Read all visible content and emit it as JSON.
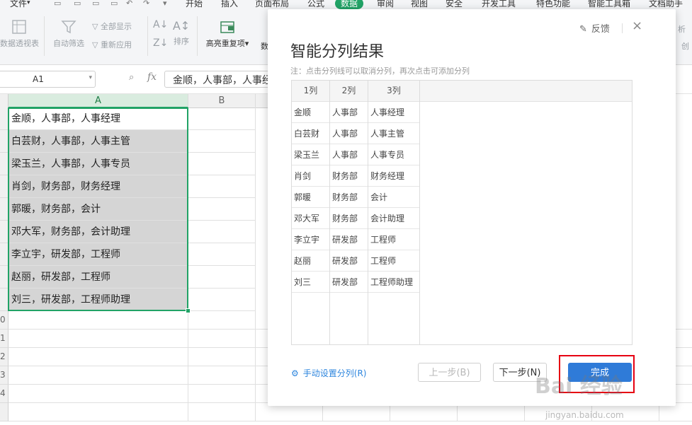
{
  "menu": {
    "items": [
      "文件",
      "开始",
      "插入",
      "页面布局",
      "公式",
      "数据",
      "审阅",
      "视图",
      "安全",
      "开发工具",
      "特色功能",
      "智能工具箱",
      "文档助手"
    ],
    "active": "数据"
  },
  "toolbar": {
    "pivot": "数据透视表",
    "autofilter": "自动筛选",
    "show_all": "全部显示",
    "reapply": "重新应用",
    "sort": "排序",
    "highlight_dup": "高亮重复项",
    "highlight_dup_caret": "▾",
    "data_partial": "数",
    "right_partial_1": "析",
    "right_partial_2": "创"
  },
  "formula_bar": {
    "name_box": "A1",
    "fx": "fx",
    "content": "金顺，人事部，人事经理"
  },
  "sheet": {
    "columns": [
      "A",
      "B"
    ],
    "row_numbers": [
      "0",
      "1",
      "2",
      "3",
      "4"
    ],
    "cells": [
      "金顺，人事部，人事经理",
      "白芸财，人事部，人事主管",
      "梁玉兰，人事部，人事专员",
      "肖剑，财务部，财务经理",
      "郭暖，财务部，会计",
      "邓大军，财务部，会计助理",
      "李立宇，研发部，工程师",
      "赵丽，研发部，工程师",
      "刘三，研发部，工程师助理"
    ]
  },
  "dialog": {
    "title": "智能分列结果",
    "note": "注：点击分列线可以取消分列，再次点击可添加分列",
    "feedback": "反馈",
    "close": "×",
    "headers": [
      "1列",
      "2列",
      "3列"
    ],
    "rows": [
      [
        "金顺",
        "人事部",
        "人事经理"
      ],
      [
        "白芸财",
        "人事部",
        "人事主管"
      ],
      [
        "梁玉兰",
        "人事部",
        "人事专员"
      ],
      [
        "肖剑",
        "财务部",
        "财务经理"
      ],
      [
        "郭暖",
        "财务部",
        "会计"
      ],
      [
        "邓大军",
        "财务部",
        "会计助理"
      ],
      [
        "李立宇",
        "研发部",
        "工程师"
      ],
      [
        "赵丽",
        "研发部",
        "工程师"
      ],
      [
        "刘三",
        "研发部",
        "工程师助理"
      ]
    ],
    "manual_split": "手动设置分列(R)",
    "prev": "上一步(B)",
    "next": "下一步(N)",
    "finish": "完成"
  },
  "watermark": {
    "main": "Bai 经验",
    "url": "jingyan.baidu.com"
  },
  "colors": {
    "accent_green": "#21a366",
    "primary_blue": "#2f7bd8",
    "highlight_red": "#e60012"
  }
}
